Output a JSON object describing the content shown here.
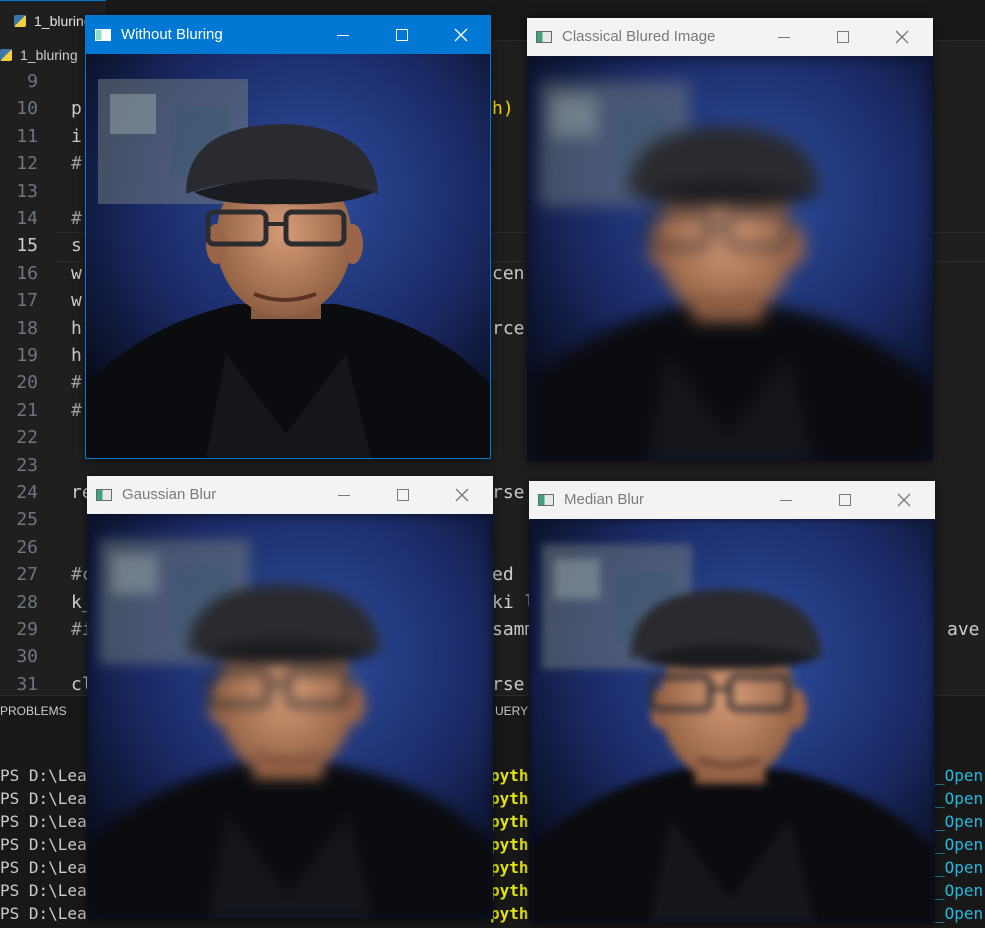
{
  "editor": {
    "tab_label": "1_bluring.",
    "breadcrumb": "1_bluring",
    "line_numbers": [
      "9",
      "10",
      "11",
      "12",
      "13",
      "14",
      "15",
      "16",
      "17",
      "18",
      "19",
      "20",
      "21",
      "22",
      "23",
      "24",
      "25",
      "26",
      "27",
      "28",
      "29",
      "30",
      "31"
    ],
    "active_line": "15",
    "visible_code": [
      {
        "left": "p",
        "right": "h)"
      },
      {
        "left": "i",
        "right": ""
      },
      {
        "left": "#",
        "right": ""
      },
      {
        "left": "",
        "right": ""
      },
      {
        "left": "#",
        "right": ""
      },
      {
        "left": "s",
        "right": ""
      },
      {
        "left": "w",
        "right": "cen"
      },
      {
        "left": "w",
        "right": ""
      },
      {
        "left": "h",
        "right": "rce"
      },
      {
        "left": "h",
        "right": ""
      },
      {
        "left": "#",
        "right": ""
      },
      {
        "left": "#",
        "right": ""
      },
      {
        "left": "",
        "right": ""
      },
      {
        "left": "",
        "right": ""
      },
      {
        "left": "re",
        "right": "rse"
      },
      {
        "left": "",
        "right": ""
      },
      {
        "left": "",
        "right": ""
      },
      {
        "left": "#c",
        "right": "ed"
      },
      {
        "left": "k_",
        "right": "ki l"
      },
      {
        "left": "#i",
        "right": "samm",
        "far": "ave"
      },
      {
        "left": "",
        "right": ""
      },
      {
        "left": "cl",
        "right": "rse"
      }
    ]
  },
  "panel": {
    "tab_problems": "PROBLEMS",
    "tab_query": "UERY R",
    "terminal_prefixes": [
      "PS D:\\Lea",
      "PS D:\\Lea",
      "PS D:\\Lea",
      "PS D:\\Lea",
      "PS D:\\Lea",
      "PS D:\\Lea",
      "PS D:\\Lea"
    ],
    "terminal_yellow": [
      "pytho",
      "pytho",
      "pytho",
      "pytho",
      "pytho",
      "pytho",
      "pytho"
    ],
    "terminal_blue": [
      "_Open(",
      "_Open(",
      "_Open(",
      "_Open(",
      "_Open(",
      "_Open(",
      "_Open("
    ]
  },
  "windows": [
    {
      "title": "Without Bluring",
      "blur": 0,
      "active": true
    },
    {
      "title": "Classical Blured Image",
      "blur": 8,
      "active": false
    },
    {
      "title": "Gaussian Blur",
      "blur": 6,
      "active": false
    },
    {
      "title": "Median Blur",
      "blur": 4,
      "active": false
    }
  ],
  "icons": {
    "app": "opencv-window-icon",
    "minimize": "minimize-icon",
    "maximize": "maximize-icon",
    "close": "close-icon"
  },
  "colors": {
    "accent": "#0078d4",
    "editor_bg": "#1f1f1f",
    "terminal_yellow": "#e5e510",
    "terminal_blue": "#29b8db"
  }
}
